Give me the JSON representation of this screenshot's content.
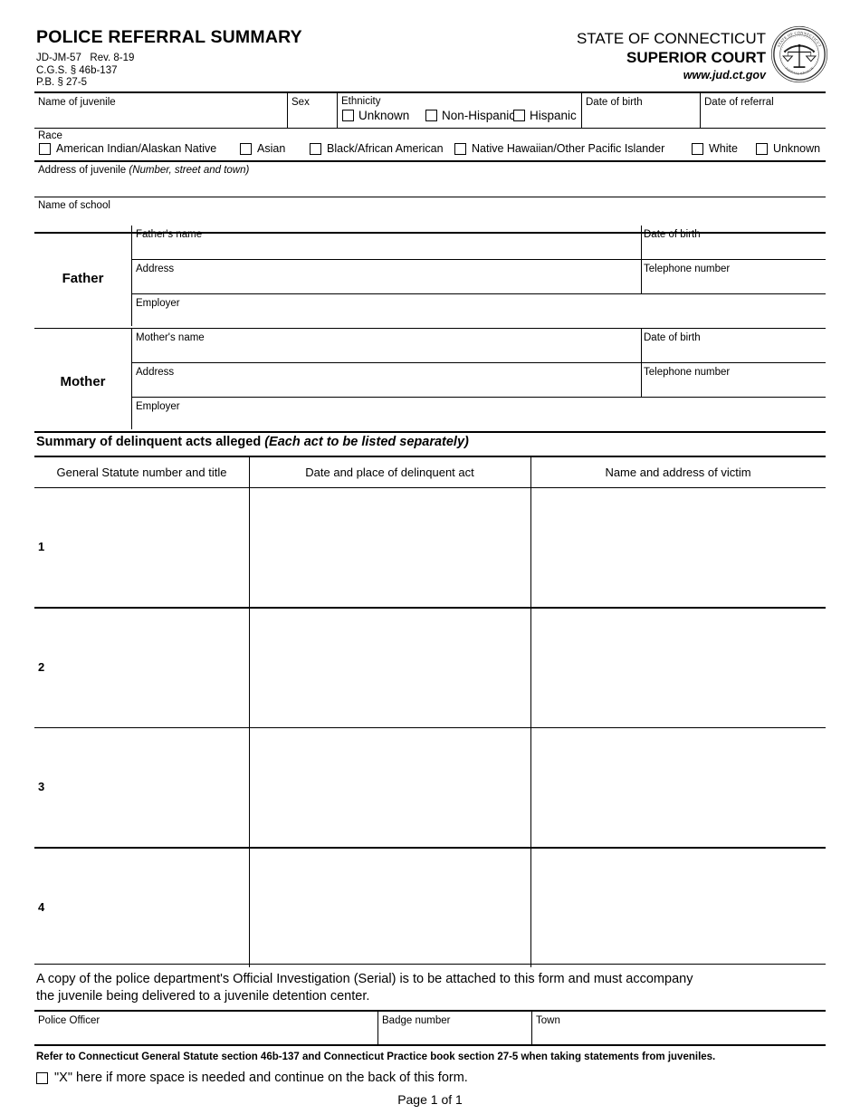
{
  "header": {
    "form_title": "POLICE REFERRAL SUMMARY",
    "form_number_line": "JD-JM-57   Rev. 8-19",
    "cgs_line": "C.G.S. § 46b-137",
    "pb_line": "P.B. § 27-5",
    "state_name": "STATE OF CONNECTICUT",
    "court_name": "SUPERIOR COURT",
    "website": "www.jud.ct.gov",
    "seal_top_text": "STATE OF CONNECTICUT",
    "seal_bottom_text": "JUDICIAL BRANCH"
  },
  "identity": {
    "name_of_juvenile_label": "Name of juvenile",
    "sex_label": "Sex",
    "ethnicity_label": "Ethnicity",
    "ethnicity_options": [
      "Unknown",
      "Non-Hispanic",
      "Hispanic"
    ],
    "date_of_birth_label": "Date of birth",
    "date_of_referral_label": "Date of referral",
    "race_label": "Race",
    "race_options": [
      "American Indian/Alaskan Native",
      "Asian",
      "Black/African American",
      "Native Hawaiian/Other Pacific Islander",
      "White",
      "Unknown"
    ],
    "address_label": "Address of juvenile ",
    "address_label_italic": "(Number, street and town)",
    "school_label": "Name of school"
  },
  "parents": [
    {
      "title": "Father",
      "name_label": "Father's name",
      "dob_label": "Date of birth",
      "address_label": "Address",
      "phone_label": "Telephone number",
      "employer_label": "Employer"
    },
    {
      "title": "Mother",
      "name_label": "Mother's name",
      "dob_label": "Date of birth",
      "address_label": "Address",
      "phone_label": "Telephone number",
      "employer_label": "Employer"
    }
  ],
  "acts": {
    "heading_regular": "Summary of delinquent acts alleged ",
    "heading_italic": "(Each act to be listed separately)",
    "columns": [
      "General Statute number and title",
      "Date and place of delinquent act",
      "Name and address of victim"
    ],
    "row_numbers": [
      "1",
      "2",
      "3",
      "4"
    ]
  },
  "footer": {
    "copy_note_line1": "A copy of the police department's Official Investigation (Serial) is to be attached to this form and must accompany",
    "copy_note_line2": "the juvenile being delivered to a juvenile detention center.",
    "police_officer_label": "Police Officer",
    "badge_number_label": "Badge number",
    "town_label": "Town",
    "refer_note": "Refer to Connecticut General Statute section 46b-137 and Connecticut Practice book section 27-5 when taking statements from juveniles.",
    "more_space_note": "\"X\" here if more space is needed and continue on the back of this form.",
    "page_number": "Page 1 of 1"
  },
  "colors": {
    "ink": "#000000",
    "paper": "#ffffff"
  }
}
